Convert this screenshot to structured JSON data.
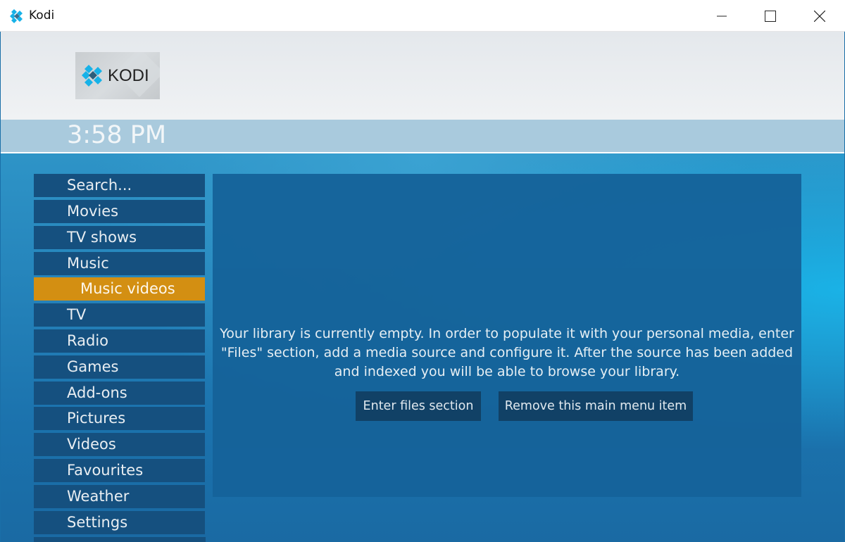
{
  "window": {
    "title": "Kodi",
    "icon": "kodi-icon",
    "controls": [
      "minimize-icon",
      "maximize-icon",
      "close-icon"
    ]
  },
  "header": {
    "logo_text": "KODI",
    "clock": "3:58 PM"
  },
  "menu": {
    "items": [
      {
        "label": "Search...",
        "active": false
      },
      {
        "label": "Movies",
        "active": false
      },
      {
        "label": "TV shows",
        "active": false
      },
      {
        "label": "Music",
        "active": false
      },
      {
        "label": "Music videos",
        "active": true
      },
      {
        "label": "TV",
        "active": false
      },
      {
        "label": "Radio",
        "active": false
      },
      {
        "label": "Games",
        "active": false
      },
      {
        "label": "Add-ons",
        "active": false
      },
      {
        "label": "Pictures",
        "active": false
      },
      {
        "label": "Videos",
        "active": false
      },
      {
        "label": "Favourites",
        "active": false
      },
      {
        "label": "Weather",
        "active": false
      },
      {
        "label": "Settings",
        "active": false
      }
    ]
  },
  "content": {
    "message_line1": "Your library is currently empty. In order to populate it with your personal media, enter",
    "message_line2": "\"Files\" section, add a media source and configure it. After the source has been added",
    "message_line3": "and indexed you will be able to browse your library.",
    "enter_files_label": "Enter files section",
    "remove_item_label": "Remove this main menu item"
  },
  "colors": {
    "menu_bg": "#15507f",
    "menu_active": "#d38f12",
    "panel_bg": "#15639a",
    "button_bg": "#113f63",
    "clockbar_bg": "#a9cadd",
    "kodi_blue": "#17b2e8"
  }
}
